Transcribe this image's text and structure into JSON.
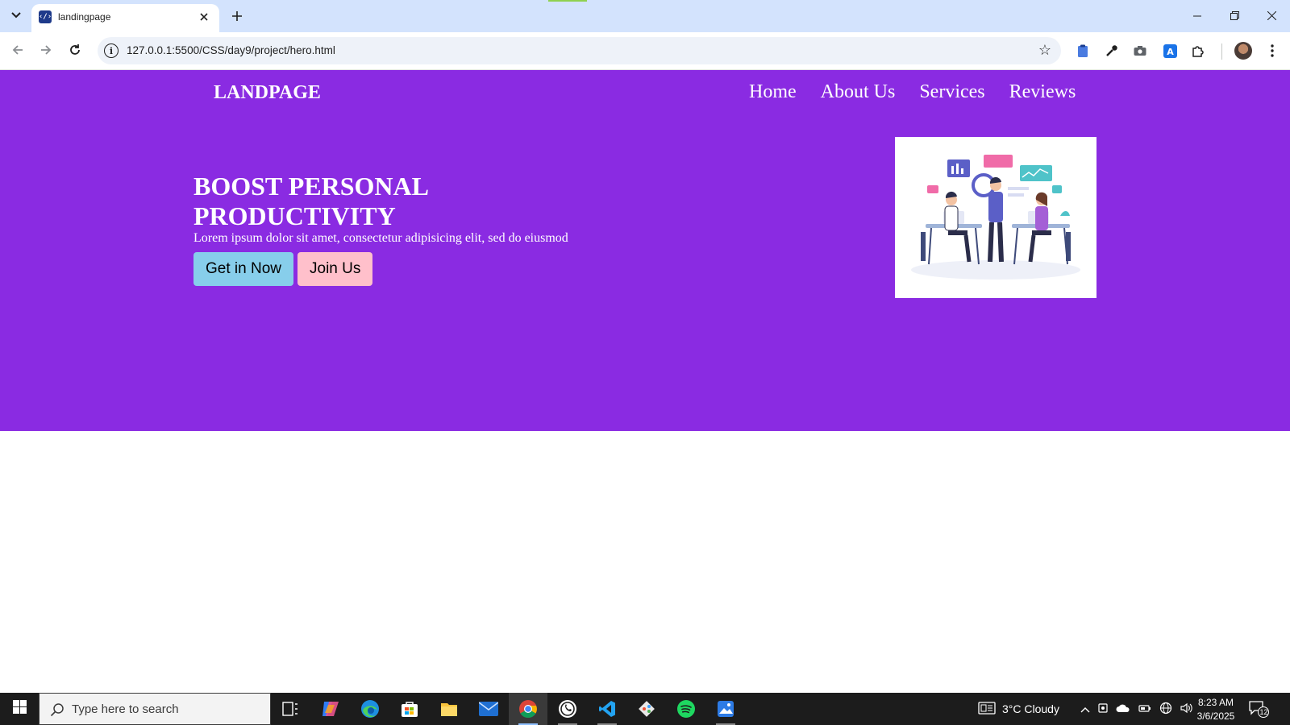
{
  "browser": {
    "tab_title": "landingpage",
    "favicon_text": "‹/›",
    "url": "127.0.0.1:5500/CSS/day9/project/hero.html",
    "icons": {
      "tab_search": "chevron-down-icon",
      "tab_close": "close-icon",
      "new_tab": "plus-icon",
      "minimize": "minimize-icon",
      "restore": "restore-icon",
      "close_window": "close-icon",
      "back": "arrow-left-icon",
      "forward": "arrow-right-icon",
      "reload": "reload-icon",
      "site_info": "info-icon",
      "bookmark": "star-icon",
      "extensions": [
        "clipboard-icon",
        "eyedropper-icon",
        "camera-icon",
        "translate-icon",
        "puzzle-icon"
      ],
      "profile": "avatar",
      "menu": "more-vertical-icon"
    }
  },
  "page": {
    "logo": "LANDPAGE",
    "nav": [
      "Home",
      "About Us",
      "Services",
      "Reviews"
    ],
    "hero": {
      "title_line1": "BOOST PERSONAL",
      "title_line2": "PRODUCTIVITY",
      "text": "Lorem ipsum dolor sit amet, consectetur adipisicing elit, sed do eiusmod",
      "primary_button": "Get in Now",
      "secondary_button": "Join Us"
    },
    "colors": {
      "hero_background": "#8a2be2",
      "primary_button": "#87ceeb",
      "secondary_button": "#ffc0cb",
      "text": "#ffffff"
    }
  },
  "taskbar": {
    "search_placeholder": "Type here to search",
    "apps": [
      "task-view-icon",
      "copilot-icon",
      "edge-icon",
      "store-icon",
      "file-explorer-icon",
      "mail-icon",
      "chrome-icon",
      "whatsapp-icon",
      "vscode-icon",
      "git-icon",
      "spotify-icon",
      "photos-icon"
    ],
    "weather": "3°C  Cloudy",
    "time": "8:23 AM",
    "date": "3/6/2025",
    "notification_count": "12"
  }
}
